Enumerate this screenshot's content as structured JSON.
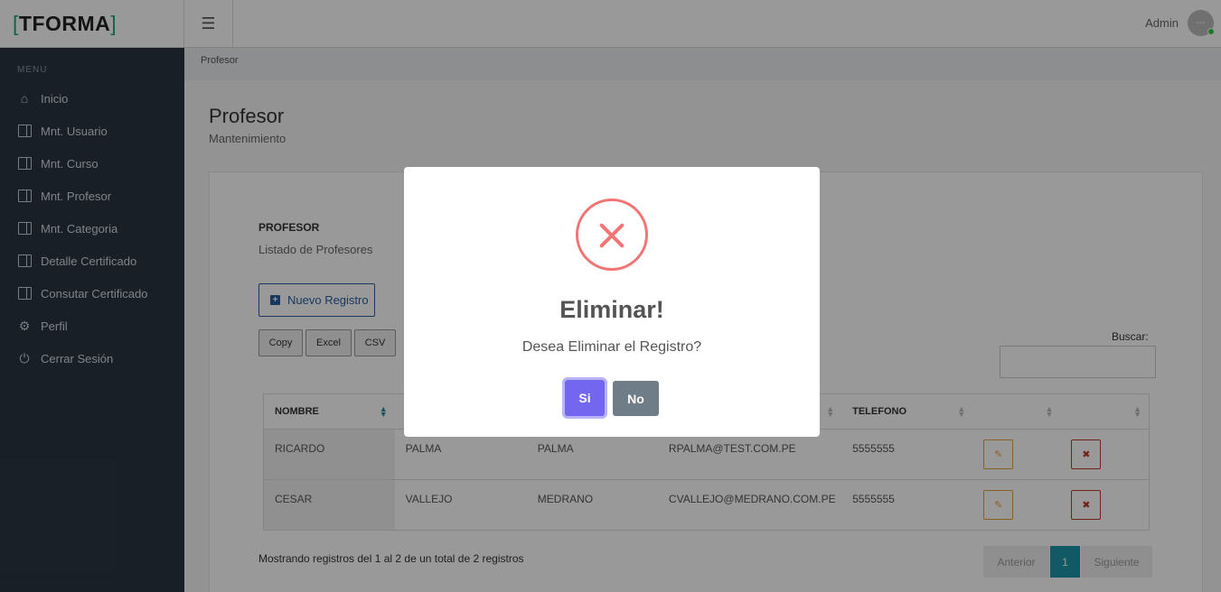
{
  "brand": {
    "logo_text": "TFORMA",
    "bracket_left": "[",
    "bracket_right": "]"
  },
  "header": {
    "user_name": "Admin",
    "avatar_text": "---"
  },
  "sidebar": {
    "menu_title": "MENU",
    "items": [
      {
        "label": "Inicio",
        "icon": "home-icon"
      },
      {
        "label": "Mnt. Usuario",
        "icon": "book-icon"
      },
      {
        "label": "Mnt. Curso",
        "icon": "book-icon"
      },
      {
        "label": "Mnt. Profesor",
        "icon": "book-icon"
      },
      {
        "label": "Mnt. Categoria",
        "icon": "book-icon"
      },
      {
        "label": "Detalle Certificado",
        "icon": "book-icon"
      },
      {
        "label": "Consutar Certificado",
        "icon": "book-icon"
      },
      {
        "label": "Perfil",
        "icon": "gear-icon"
      },
      {
        "label": "Cerrar Sesión",
        "icon": "power-icon"
      }
    ]
  },
  "breadcrumb": "Profesor",
  "page": {
    "title": "Profesor",
    "subtitle": "Mantenimiento"
  },
  "card": {
    "title": "PROFESOR",
    "subtitle": "Listado de Profesores",
    "new_button": "Nuevo Registro",
    "export_buttons": [
      "Copy",
      "Excel",
      "CSV"
    ],
    "search_label": "Buscar:",
    "search_value": ""
  },
  "table": {
    "headers": [
      "NOMBRE",
      "",
      "",
      "",
      "TELEFONO",
      "",
      ""
    ],
    "rows": [
      {
        "nombre": "RICARDO",
        "apellido_paterno": "PALMA",
        "apellido_materno": "PALMA",
        "correo": "RPALMA@TEST.COM.PE",
        "telefono": "5555555"
      },
      {
        "nombre": "CESAR",
        "apellido_paterno": "VALLEJO",
        "apellido_materno": "MEDRANO",
        "correo": "CVALLEJO@MEDRANO.COM.PE",
        "telefono": "5555555"
      }
    ]
  },
  "footer": {
    "info": "Mostrando registros del 1 al 2 de un total de 2 registros",
    "prev": "Anterior",
    "page": "1",
    "next": "Siguiente"
  },
  "modal": {
    "title": "Eliminar!",
    "text": "Desea Eliminar el Registro?",
    "confirm": "Si",
    "cancel": "No"
  },
  "colors": {
    "sidebar_bg": "#2a3542",
    "confirm": "#7367f0",
    "cancel": "#6e7d88",
    "error": "#f27474",
    "pager_active": "#1b95a8"
  }
}
